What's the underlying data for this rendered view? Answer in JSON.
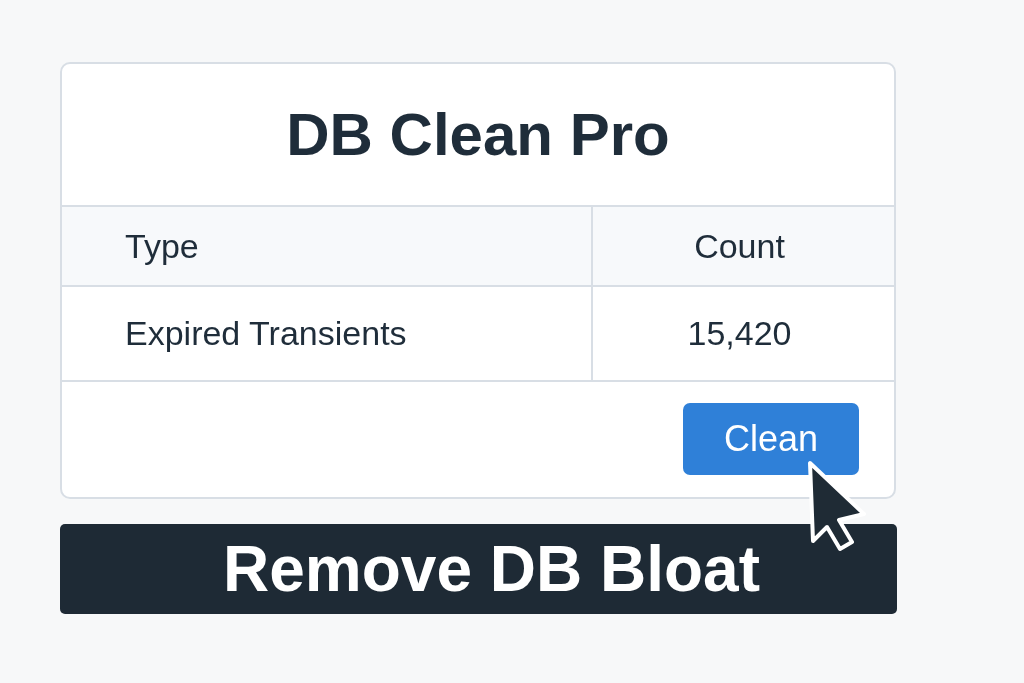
{
  "card": {
    "title": "DB Clean Pro",
    "table": {
      "columns": [
        "Type",
        "Count"
      ],
      "rows": [
        [
          "Expired Transients",
          "15,420"
        ]
      ]
    },
    "button": "Clean"
  },
  "banner": {
    "text": "Remove DB Bloat"
  }
}
